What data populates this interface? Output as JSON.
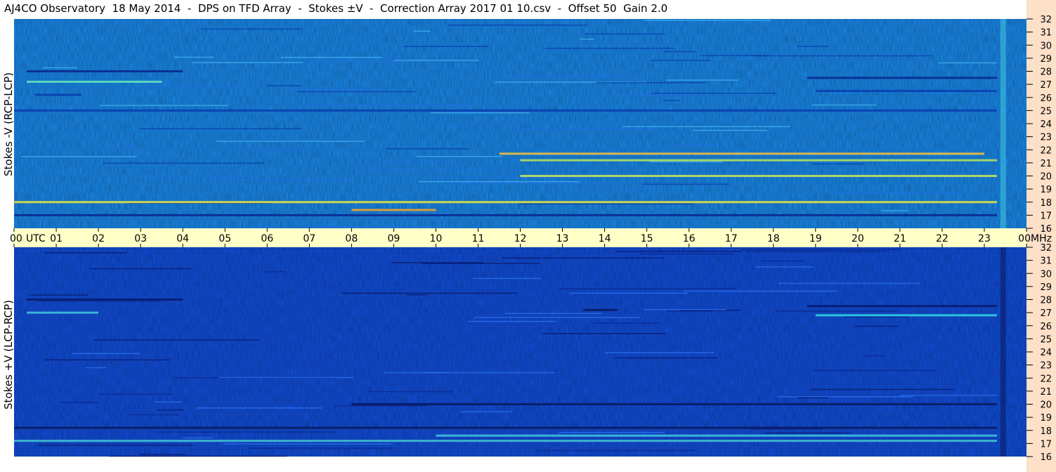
{
  "title": "AJ4CO Observatory  18 May 2014  -  DPS on TFD Array  -  Stokes ±V  -  Correction Array 2017 01 10.csv  -  Offset 50  Gain 2.0",
  "chart_data": [
    {
      "type": "heatmap",
      "title": "AJ4CO Observatory  18 May 2014  -  DPS on TFD Array  -  Stokes ±V  -  Correction Array 2017 01 10.csv  -  Offset 50  Gain 2.0",
      "panel": "top",
      "ylabel": "Stokes -V (RCP-LCP)",
      "xlabel": "UTC",
      "x_ticks": [
        "00",
        "01",
        "02",
        "03",
        "04",
        "05",
        "06",
        "07",
        "08",
        "09",
        "10",
        "11",
        "12",
        "13",
        "14",
        "15",
        "16",
        "17",
        "18",
        "19",
        "20",
        "21",
        "22",
        "23",
        "00"
      ],
      "y_ticks": [
        "32",
        "31",
        "30",
        "29",
        "28",
        "27",
        "26",
        "25",
        "24",
        "23",
        "22",
        "21",
        "20",
        "19",
        "18",
        "17",
        "16"
      ],
      "xlim": [
        0,
        24
      ],
      "ylim": [
        16,
        32
      ],
      "colormap": "jet",
      "base_color": "#1a8cf0",
      "features": [
        {
          "freq": 28.0,
          "t0": 0.3,
          "t1": 4.0,
          "color": "#0a2a90"
        },
        {
          "freq": 27.2,
          "t0": 0.3,
          "t1": 3.5,
          "color": "#60e0c0"
        },
        {
          "freq": 26.2,
          "t0": 0.5,
          "t1": 1.6,
          "color": "#0a3fb0"
        },
        {
          "freq": 27.5,
          "t0": 18.8,
          "t1": 23.3,
          "color": "#0a2a90"
        },
        {
          "freq": 26.5,
          "t0": 19.0,
          "t1": 23.3,
          "color": "#0a40b0"
        },
        {
          "freq": 21.7,
          "t0": 11.5,
          "t1": 23.0,
          "color": "#f0c040"
        },
        {
          "freq": 21.2,
          "t0": 12.0,
          "t1": 23.3,
          "color": "#b0e060"
        },
        {
          "freq": 20.0,
          "t0": 12.0,
          "t1": 23.3,
          "color": "#c0e060"
        },
        {
          "freq": 18.0,
          "t0": 0.0,
          "t1": 23.3,
          "color": "#e0e040"
        },
        {
          "freq": 17.4,
          "t0": 8.0,
          "t1": 10.0,
          "color": "#f0a030"
        },
        {
          "freq": 17.0,
          "t0": 0.0,
          "t1": 23.3,
          "color": "#0a2a90"
        },
        {
          "freq": 25.0,
          "t0": 0.0,
          "t1": 23.3,
          "color": "#0a3fb0"
        }
      ]
    },
    {
      "type": "heatmap",
      "panel": "bottom",
      "ylabel": "Stokes +V (LCP-RCP)",
      "xlabel": "UTC",
      "x_ticks": [
        "00",
        "01",
        "02",
        "03",
        "04",
        "05",
        "06",
        "07",
        "08",
        "09",
        "10",
        "11",
        "12",
        "13",
        "14",
        "15",
        "16",
        "17",
        "18",
        "19",
        "20",
        "21",
        "22",
        "23",
        "00"
      ],
      "y_ticks": [
        "32",
        "31",
        "30",
        "29",
        "28",
        "27",
        "26",
        "25",
        "24",
        "23",
        "22",
        "21",
        "20",
        "19",
        "18",
        "17",
        "16"
      ],
      "xlim": [
        0,
        24
      ],
      "ylim": [
        16,
        32
      ],
      "colormap": "jet",
      "base_color": "#1250e0",
      "features": [
        {
          "freq": 28.0,
          "t0": 0.3,
          "t1": 4.0,
          "color": "#0a1a70"
        },
        {
          "freq": 27.0,
          "t0": 0.3,
          "t1": 2.0,
          "color": "#40c0e0"
        },
        {
          "freq": 27.2,
          "t0": 13.5,
          "t1": 14.3,
          "color": "#0a1a60"
        },
        {
          "freq": 27.5,
          "t0": 18.8,
          "t1": 23.3,
          "color": "#0a1a70"
        },
        {
          "freq": 26.8,
          "t0": 19.0,
          "t1": 23.3,
          "color": "#30d0e0"
        },
        {
          "freq": 20.0,
          "t0": 8.0,
          "t1": 23.3,
          "color": "#0a1a60"
        },
        {
          "freq": 18.2,
          "t0": 0.0,
          "t1": 23.3,
          "color": "#0a1a60"
        },
        {
          "freq": 17.6,
          "t0": 10.0,
          "t1": 23.3,
          "color": "#40c0e0"
        },
        {
          "freq": 17.2,
          "t0": 0.0,
          "t1": 23.3,
          "color": "#40c0d0"
        }
      ]
    }
  ],
  "panel_labels": {
    "top": "Stokes -V (RCP-LCP)",
    "bottom": "Stokes +V (LCP-RCP)"
  },
  "axis": {
    "utc_label": "UTC",
    "mhz_label": "MHz"
  },
  "colors": {
    "axis_band": "#ffffc8",
    "right_band": "#fde0c8",
    "tick": "#000000"
  }
}
